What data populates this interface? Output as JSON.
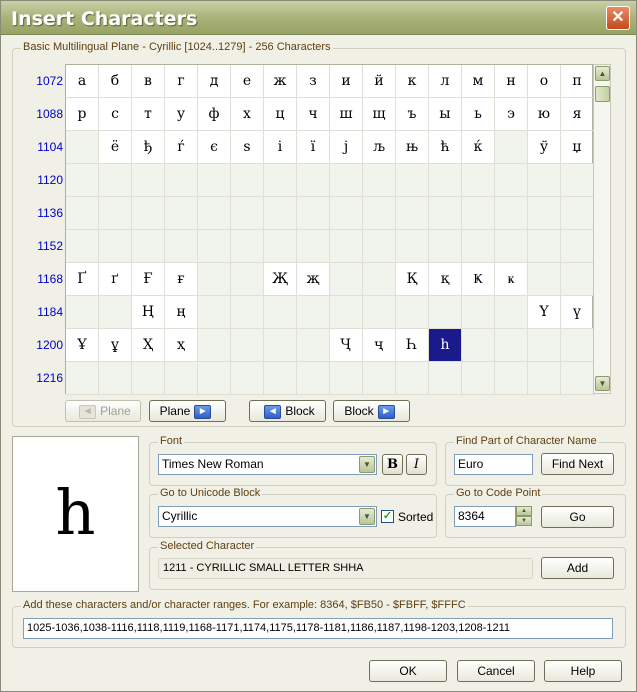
{
  "window": {
    "title": "Insert Characters",
    "close_label": "✕"
  },
  "grid_group": {
    "label": "Basic Multilingual Plane - Cyrillic [1024..1279] - 256 Characters"
  },
  "row_numbers": [
    "1072",
    "1088",
    "1104",
    "1120",
    "1136",
    "1152",
    "1168",
    "1184",
    "1200",
    "1216"
  ],
  "rows": [
    [
      "а",
      "б",
      "в",
      "г",
      "д",
      "е",
      "ж",
      "з",
      "и",
      "й",
      "к",
      "л",
      "м",
      "н",
      "о",
      "п"
    ],
    [
      "р",
      "с",
      "т",
      "у",
      "ф",
      "х",
      "ц",
      "ч",
      "ш",
      "щ",
      "ъ",
      "ы",
      "ь",
      "э",
      "ю",
      "я"
    ],
    [
      "",
      "ё",
      "ђ",
      "ѓ",
      "є",
      "s",
      "і",
      "ї",
      "j",
      "љ",
      "њ",
      "ћ",
      "ќ",
      "",
      "ў",
      "џ"
    ],
    [
      "",
      "",
      "",
      "",
      "",
      "",
      "",
      "",
      "",
      "",
      "",
      "",
      "",
      "",
      "",
      ""
    ],
    [
      "",
      "",
      "",
      "",
      "",
      "",
      "",
      "",
      "",
      "",
      "",
      "",
      "",
      "",
      "",
      ""
    ],
    [
      "",
      "",
      "",
      "",
      "",
      "",
      "",
      "",
      "",
      "",
      "",
      "",
      "",
      "",
      "",
      ""
    ],
    [
      "Ґ",
      "ґ",
      "Ғ",
      "ғ",
      "",
      "",
      "Җ",
      "җ",
      "",
      "",
      "Қ",
      "қ",
      "Ҝ",
      "ҝ",
      "",
      ""
    ],
    [
      "",
      "",
      "Ң",
      "ң",
      "",
      "",
      "",
      "",
      "",
      "",
      "",
      "",
      "",
      "",
      "Ү",
      "ү"
    ],
    [
      "Ұ",
      "ұ",
      "Ҳ",
      "ҳ",
      "",
      "",
      "",
      "",
      "Ҷ",
      "ҷ",
      "Һ",
      "һ",
      "",
      "",
      "",
      ""
    ],
    [
      "",
      "",
      "",
      "",
      "",
      "",
      "",
      "",
      "",
      "",
      "",
      "",
      "",
      "",
      "",
      ""
    ]
  ],
  "selected_cell": {
    "row": 8,
    "col": 11
  },
  "nav_buttons": [
    {
      "label": "Plane",
      "arrow": "◄",
      "disabled": true
    },
    {
      "label": "Plane",
      "arrow": "►",
      "disabled": false
    },
    {
      "label": "Block",
      "arrow": "◄",
      "disabled": false
    },
    {
      "label": "Block",
      "arrow": "►",
      "disabled": false
    }
  ],
  "preview_char": "h",
  "font": {
    "label": "Font",
    "value": "Times New Roman",
    "bold_label": "B",
    "italic_label": "I"
  },
  "find_name": {
    "label": "Find Part of Character Name",
    "value": "Euro",
    "button_label": "Find Next"
  },
  "unicode_block": {
    "label": "Go to Unicode Block",
    "value": "Cyrillic",
    "sorted_label": "Sorted",
    "sorted_checked": true
  },
  "code_point": {
    "label": "Go to Code Point",
    "value": "8364",
    "button_label": "Go"
  },
  "selected_character": {
    "label": "Selected Character",
    "value": "1211 - CYRILLIC SMALL LETTER SHHA",
    "button_label": "Add"
  },
  "ranges": {
    "label": "Add these characters and/or character ranges. For example: 8364, $FB50 - $FBFF, $FFFC",
    "value": "1025-1036,1038-1116,1118,1119,1168-1171,1174,1175,1178-1181,1186,1187,1198-1203,1208-1211"
  },
  "footer": {
    "ok_label": "OK",
    "cancel_label": "Cancel",
    "help_label": "Help"
  }
}
